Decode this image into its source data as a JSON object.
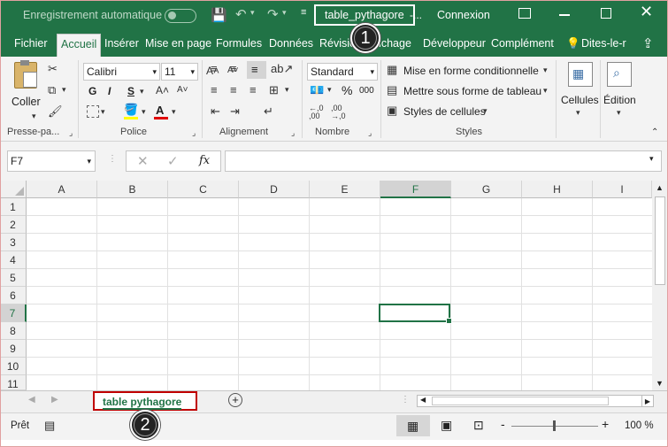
{
  "titlebar": {
    "autosave_label": "Enregistrement automatique",
    "filename": "table_pythagore",
    "filename_suffix": "-...",
    "signin": "Connexion",
    "colors": {
      "background": "#217346",
      "highlight_border": "#ffffff"
    }
  },
  "tabs": [
    "Fichier",
    "Accueil",
    "Insérer",
    "Mise en page",
    "Formules",
    "Données",
    "Révision",
    "Affichage",
    "Développeur",
    "Complément",
    "Dites-le-r"
  ],
  "active_tab": "Accueil",
  "ribbon": {
    "clipboard": {
      "paste_label": "Coller",
      "group_label": "Presse-pa..."
    },
    "font": {
      "font_name": "Calibri",
      "font_size": "11",
      "bold": "G",
      "italic": "I",
      "underline": "S",
      "group_label": "Police"
    },
    "alignment": {
      "group_label": "Alignement"
    },
    "number": {
      "format": "Standard",
      "percent": "%",
      "thousands": "000",
      "inc_decimal": "←,0\n,00",
      "group_label": "Nombre"
    },
    "styles": {
      "conditional": "Mise en forme conditionnelle",
      "table": "Mettre sous forme de tableau",
      "cell_styles": "Styles de cellules",
      "group_label": "Styles"
    },
    "cells": {
      "label": "Cellules"
    },
    "editing": {
      "label": "Édition"
    }
  },
  "formula_bar": {
    "name_box": "F7",
    "fx": "fx",
    "value": ""
  },
  "grid": {
    "columns": [
      "A",
      "B",
      "C",
      "D",
      "E",
      "F",
      "G",
      "H",
      "I"
    ],
    "rows": [
      "1",
      "2",
      "3",
      "4",
      "5",
      "6",
      "7",
      "8",
      "9",
      "10",
      "11"
    ],
    "selected_column": "F",
    "selected_row": "7",
    "accent": "#217346"
  },
  "sheets": {
    "tabs": [
      "table pythagore"
    ],
    "active": "table pythagore",
    "highlight": "#c00000"
  },
  "status": {
    "ready": "Prêt",
    "zoom": "100 %",
    "zoom_minus": "-",
    "zoom_plus": "+"
  },
  "callouts": [
    "1",
    "2"
  ]
}
